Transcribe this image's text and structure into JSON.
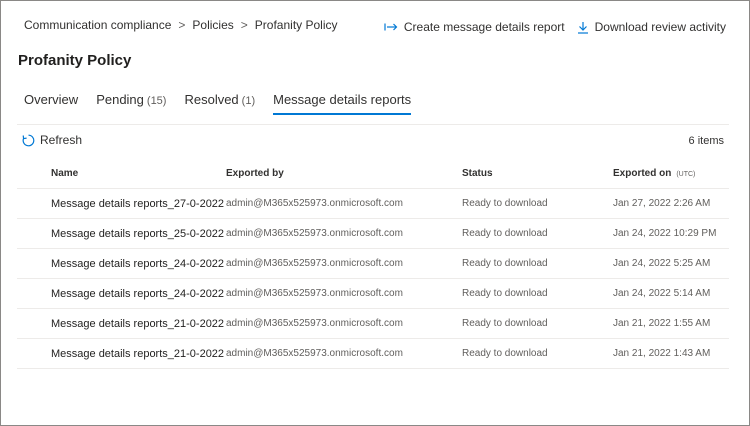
{
  "breadcrumb": {
    "items": [
      "Communication compliance",
      "Policies",
      "Profanity Policy"
    ],
    "separator": ">"
  },
  "header_actions": {
    "create_report": "Create message details report",
    "download_activity": "Download review activity",
    "create_icon": "arrow-to-right-icon",
    "download_icon": "download-icon"
  },
  "page_title": "Profanity Policy",
  "tabs": [
    {
      "label": "Overview",
      "count": ""
    },
    {
      "label": "Pending",
      "count": "(15)"
    },
    {
      "label": "Resolved",
      "count": "(1)"
    },
    {
      "label": "Message details reports",
      "count": ""
    }
  ],
  "active_tab": "Message details reports",
  "toolbar": {
    "refresh_label": "Refresh",
    "refresh_icon": "refresh-icon",
    "items_count": "6 items"
  },
  "table": {
    "columns": [
      "Name",
      "Exported by",
      "Status",
      "Exported on",
      "(UTC)"
    ],
    "rows": [
      {
        "name": "Message details reports_27-0-2022",
        "exported_by": "admin@M365x525973.onmicrosoft.com",
        "status": "Ready to download",
        "exported_on": "Jan 27, 2022 2:26 AM"
      },
      {
        "name": "Message details reports_25-0-2022",
        "exported_by": "admin@M365x525973.onmicrosoft.com",
        "status": "Ready to download",
        "exported_on": "Jan 24, 2022 10:29 PM"
      },
      {
        "name": "Message details reports_24-0-2022",
        "exported_by": "admin@M365x525973.onmicrosoft.com",
        "status": "Ready to download",
        "exported_on": "Jan 24, 2022 5:25 AM"
      },
      {
        "name": "Message details reports_24-0-2022",
        "exported_by": "admin@M365x525973.onmicrosoft.com",
        "status": "Ready to download",
        "exported_on": "Jan 24, 2022 5:14 AM"
      },
      {
        "name": "Message details reports_21-0-2022",
        "exported_by": "admin@M365x525973.onmicrosoft.com",
        "status": "Ready to download",
        "exported_on": "Jan 21, 2022 1:55 AM"
      },
      {
        "name": "Message details reports_21-0-2022",
        "exported_by": "admin@M365x525973.onmicrosoft.com",
        "status": "Ready to download",
        "exported_on": "Jan 21, 2022 1:43 AM"
      }
    ]
  },
  "colors": {
    "accent": "#0078d4",
    "text": "#323130",
    "divider": "#edebe9"
  }
}
